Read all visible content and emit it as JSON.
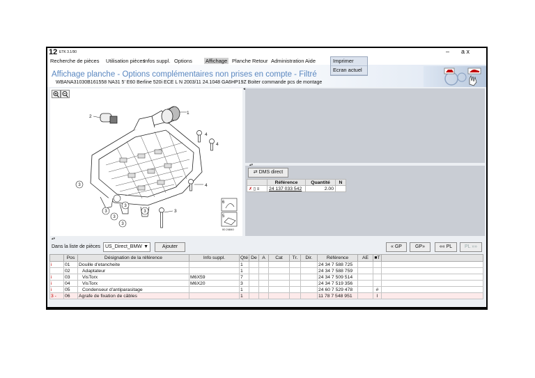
{
  "app": {
    "number": "12",
    "name": "ETK 3.1/90",
    "minimize": "–",
    "controls": "a x"
  },
  "menu": [
    {
      "label": "Recherche de pièces"
    },
    {
      "label": "Utilisation pièces"
    },
    {
      "label": "Infos suppl."
    },
    {
      "label": "Options"
    },
    {
      "label": "Affichage"
    },
    {
      "label": "Planche"
    },
    {
      "label": "Retour"
    },
    {
      "label": "Administration"
    },
    {
      "label": "Aide"
    }
  ],
  "dropdown": {
    "items": [
      {
        "label": "Imprimer"
      },
      {
        "label": "Ecran actuel"
      }
    ]
  },
  "header": {
    "title": "Affichage planche - Options complémentaires non prises en compte - Filtré",
    "subtitle": "WBANA31030B161558 NA31 5' E60 Berline 520i ECE L N 2003/11 24.1048 GA6HP19Z Boiter commande pcs de montage"
  },
  "diagram": {
    "callouts": [
      "1",
      "2",
      "4",
      "4",
      "4",
      "3",
      "3",
      "3",
      "3",
      "3",
      "3",
      "3",
      "6",
      "5"
    ],
    "ref_number": "00 24840"
  },
  "dms": {
    "button": "DMS direct",
    "headers": [
      "Référence",
      "Quantité",
      "N"
    ],
    "row": {
      "reference": "24 137 033 542",
      "quantity": "2.00",
      "n": ""
    }
  },
  "toolbar": {
    "list_label": "Dans la liste de pièces",
    "list_value": "US_Direct_BMW",
    "add_button": "Ajouter",
    "nav_buttons": [
      {
        "label": "« GP",
        "disabled": false
      },
      {
        "label": "GP»",
        "disabled": false
      },
      {
        "label": "«« PL",
        "disabled": false
      },
      {
        "label": "PL »»",
        "disabled": true
      }
    ]
  },
  "parts_table": {
    "headers": [
      "Pos",
      "Désignation de la référence",
      "Info suppl.",
      "Qté",
      "De",
      "A",
      "Cat",
      "Tr.",
      "Dir.",
      "Référence",
      "AE",
      "■T"
    ],
    "rows": [
      {
        "mark": "i",
        "pos": "01",
        "designation": "Douille d'etancheite",
        "info": "",
        "qty": "1",
        "ref": "24 34 7 588 725",
        "t": "",
        "indent": false
      },
      {
        "mark": "",
        "pos": "02",
        "designation": "Adaptateur",
        "info": "",
        "qty": "1",
        "ref": "24 34 7 588 759",
        "t": "",
        "indent": true
      },
      {
        "mark": "i",
        "pos": "03",
        "designation": "VisTorx",
        "info": "M6X59",
        "qty": "7",
        "ref": "24 34 7 509 514",
        "t": "",
        "indent": true
      },
      {
        "mark": "i",
        "pos": "04",
        "designation": "VisTorx",
        "info": "M6X20",
        "qty": "3",
        "ref": "24 34 7 519 356",
        "t": "",
        "indent": true
      },
      {
        "mark": "i",
        "pos": "05",
        "designation": "Condenseur d'antiparasitage",
        "info": "",
        "qty": "1",
        "ref": "24 60 7 529 478",
        "t": "#",
        "indent": true
      },
      {
        "mark": "3 - ",
        "pos": "06",
        "designation": "Agrafe de fixation de câbles",
        "info": "",
        "qty": "1",
        "ref": "11 78 7 548 951",
        "t": "I",
        "indent": false
      }
    ]
  },
  "colors": {
    "title_blue": "#5a87c0",
    "mark_red": "#c00000"
  }
}
